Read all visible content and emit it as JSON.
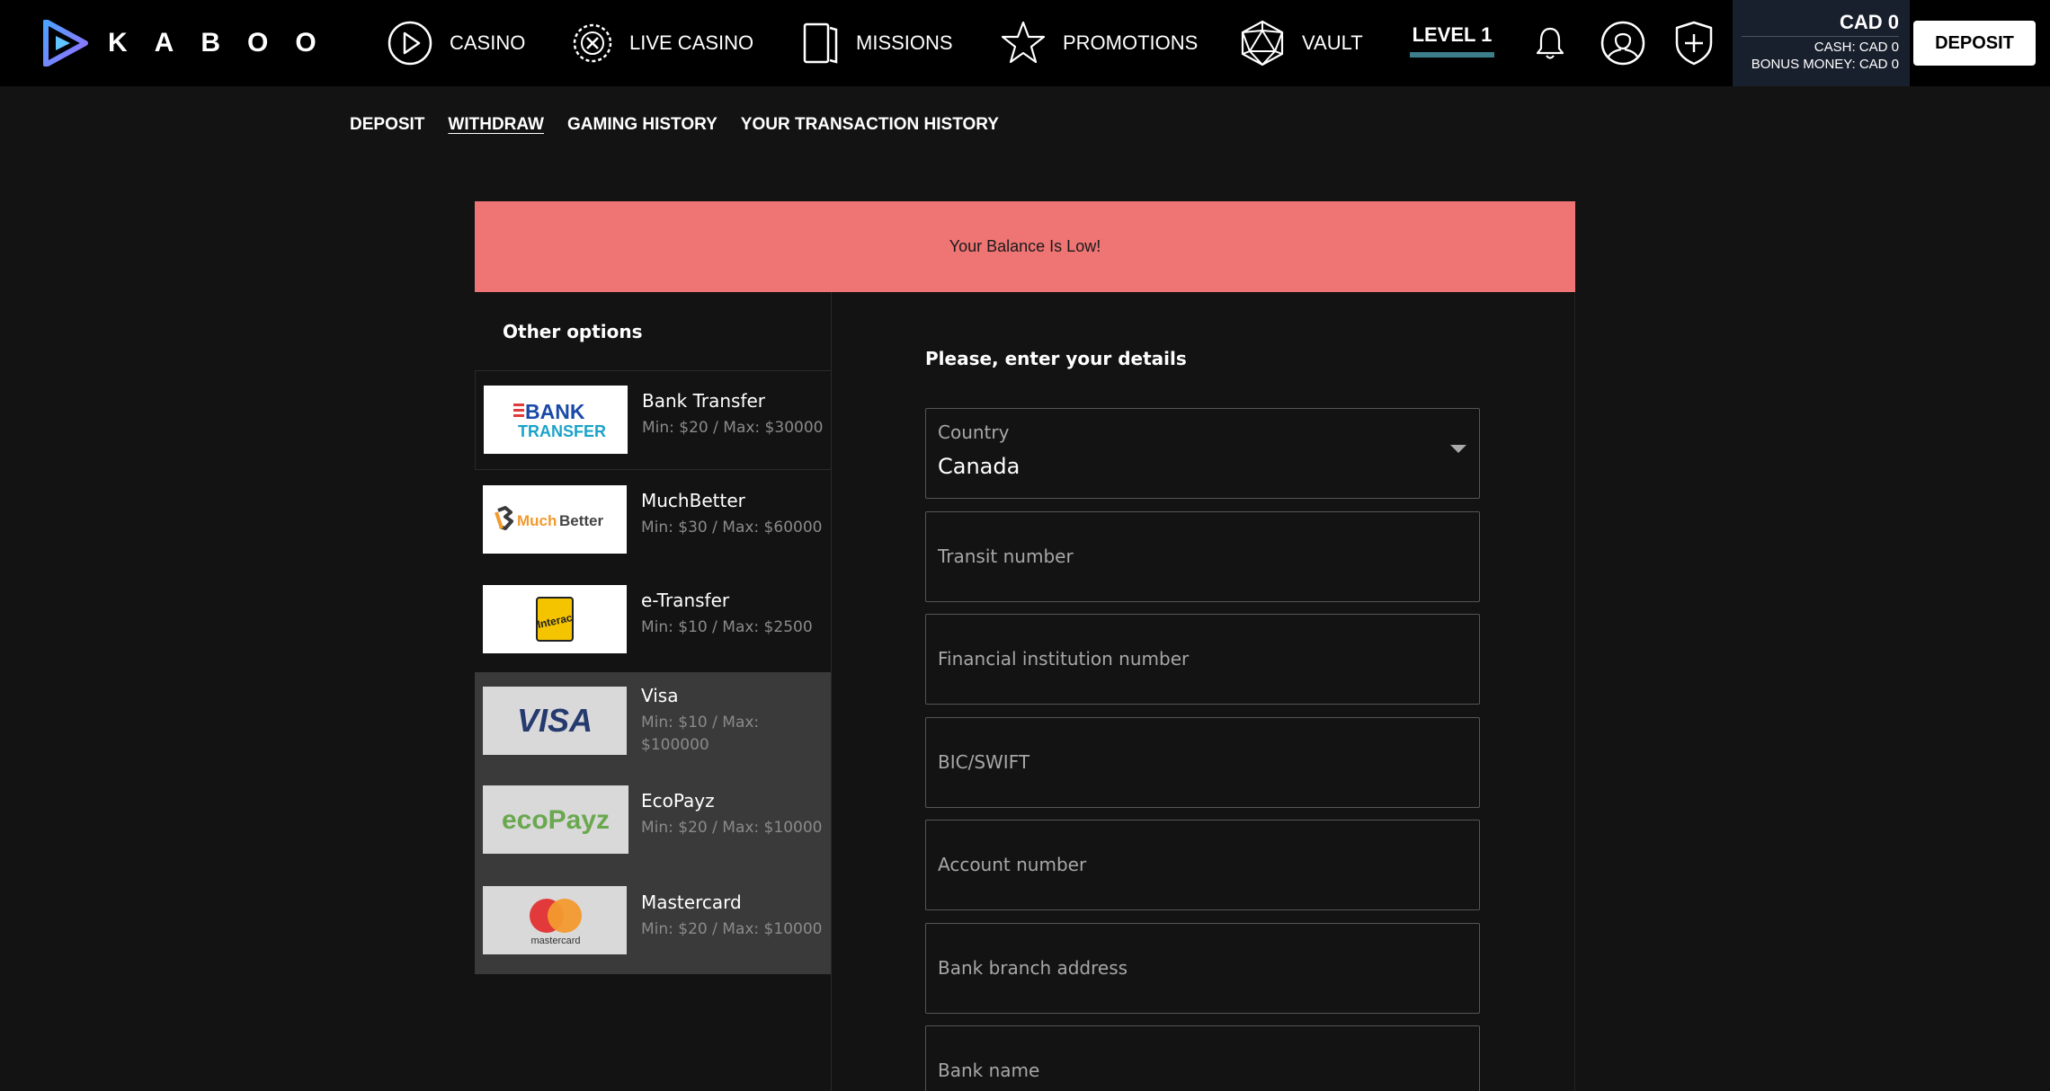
{
  "brand": {
    "name": "KABOO"
  },
  "nav": {
    "items": [
      {
        "label": "CASINO",
        "icon": "play-circle-icon"
      },
      {
        "label": "LIVE CASINO",
        "icon": "poker-chip-icon"
      },
      {
        "label": "MISSIONS",
        "icon": "cards-icon"
      },
      {
        "label": "PROMOTIONS",
        "icon": "star-icon"
      },
      {
        "label": "VAULT",
        "icon": "d20-dice-icon"
      }
    ],
    "level": "LEVEL 1"
  },
  "account": {
    "balance": "CAD 0",
    "cash": "CASH: CAD 0",
    "bonus": "BONUS MONEY: CAD 0",
    "deposit_label": "DEPOSIT"
  },
  "subnav": {
    "tabs": [
      "DEPOSIT",
      "WITHDRAW",
      "GAMING HISTORY",
      "YOUR TRANSACTION HISTORY"
    ],
    "active": "WITHDRAW"
  },
  "alert": {
    "message": "Your Balance Is Low!",
    "color": "#ef7474"
  },
  "payment": {
    "title": "Other options",
    "methods": [
      {
        "name": "Bank Transfer",
        "limits": "Min: $20 / Max: $30000",
        "logo_text": [
          "BANK",
          "TRANSFER"
        ]
      },
      {
        "name": "MuchBetter",
        "limits": "Min: $30 / Max: $60000",
        "logo_text": "MuchBetter"
      },
      {
        "name": "e-Transfer",
        "limits": "Min: $10 / Max: $2500",
        "logo_text": "Interac"
      },
      {
        "name": "Visa",
        "limits": "Min: $10 / Max: $100000",
        "logo_text": "VISA",
        "limits_lines": [
          "Min: $10 / Max:",
          "$100000"
        ]
      },
      {
        "name": "EcoPayz",
        "limits": "Min: $20 / Max: $10000",
        "logo_text": "ecoPayz"
      },
      {
        "name": "Mastercard",
        "limits": "Min: $20 / Max: $10000",
        "logo_text": "mastercard"
      }
    ]
  },
  "form": {
    "title": "Please, enter your details",
    "country_label": "Country",
    "country_value": "Canada",
    "fields": [
      "Transit number",
      "Financial institution number",
      "BIC/SWIFT",
      "Account number",
      "Bank branch address",
      "Bank name"
    ]
  },
  "colors": {
    "accent_level": "#3d7e8c",
    "balance_bg": "#19202d",
    "selected_group_bg": "#3a3a3a"
  }
}
